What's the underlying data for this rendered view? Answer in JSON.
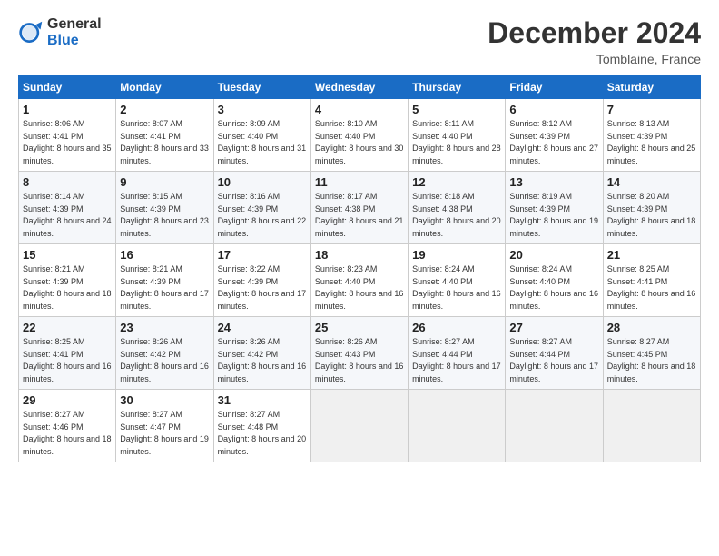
{
  "logo": {
    "general": "General",
    "blue": "Blue"
  },
  "title": "December 2024",
  "location": "Tomblaine, France",
  "weekdays": [
    "Sunday",
    "Monday",
    "Tuesday",
    "Wednesday",
    "Thursday",
    "Friday",
    "Saturday"
  ],
  "weeks": [
    [
      {
        "day": "1",
        "sunrise": "8:06 AM",
        "sunset": "4:41 PM",
        "daylight": "8 hours and 35 minutes."
      },
      {
        "day": "2",
        "sunrise": "8:07 AM",
        "sunset": "4:41 PM",
        "daylight": "8 hours and 33 minutes."
      },
      {
        "day": "3",
        "sunrise": "8:09 AM",
        "sunset": "4:40 PM",
        "daylight": "8 hours and 31 minutes."
      },
      {
        "day": "4",
        "sunrise": "8:10 AM",
        "sunset": "4:40 PM",
        "daylight": "8 hours and 30 minutes."
      },
      {
        "day": "5",
        "sunrise": "8:11 AM",
        "sunset": "4:40 PM",
        "daylight": "8 hours and 28 minutes."
      },
      {
        "day": "6",
        "sunrise": "8:12 AM",
        "sunset": "4:39 PM",
        "daylight": "8 hours and 27 minutes."
      },
      {
        "day": "7",
        "sunrise": "8:13 AM",
        "sunset": "4:39 PM",
        "daylight": "8 hours and 25 minutes."
      }
    ],
    [
      {
        "day": "8",
        "sunrise": "8:14 AM",
        "sunset": "4:39 PM",
        "daylight": "8 hours and 24 minutes."
      },
      {
        "day": "9",
        "sunrise": "8:15 AM",
        "sunset": "4:39 PM",
        "daylight": "8 hours and 23 minutes."
      },
      {
        "day": "10",
        "sunrise": "8:16 AM",
        "sunset": "4:39 PM",
        "daylight": "8 hours and 22 minutes."
      },
      {
        "day": "11",
        "sunrise": "8:17 AM",
        "sunset": "4:38 PM",
        "daylight": "8 hours and 21 minutes."
      },
      {
        "day": "12",
        "sunrise": "8:18 AM",
        "sunset": "4:38 PM",
        "daylight": "8 hours and 20 minutes."
      },
      {
        "day": "13",
        "sunrise": "8:19 AM",
        "sunset": "4:39 PM",
        "daylight": "8 hours and 19 minutes."
      },
      {
        "day": "14",
        "sunrise": "8:20 AM",
        "sunset": "4:39 PM",
        "daylight": "8 hours and 18 minutes."
      }
    ],
    [
      {
        "day": "15",
        "sunrise": "8:21 AM",
        "sunset": "4:39 PM",
        "daylight": "8 hours and 18 minutes."
      },
      {
        "day": "16",
        "sunrise": "8:21 AM",
        "sunset": "4:39 PM",
        "daylight": "8 hours and 17 minutes."
      },
      {
        "day": "17",
        "sunrise": "8:22 AM",
        "sunset": "4:39 PM",
        "daylight": "8 hours and 17 minutes."
      },
      {
        "day": "18",
        "sunrise": "8:23 AM",
        "sunset": "4:40 PM",
        "daylight": "8 hours and 16 minutes."
      },
      {
        "day": "19",
        "sunrise": "8:24 AM",
        "sunset": "4:40 PM",
        "daylight": "8 hours and 16 minutes."
      },
      {
        "day": "20",
        "sunrise": "8:24 AM",
        "sunset": "4:40 PM",
        "daylight": "8 hours and 16 minutes."
      },
      {
        "day": "21",
        "sunrise": "8:25 AM",
        "sunset": "4:41 PM",
        "daylight": "8 hours and 16 minutes."
      }
    ],
    [
      {
        "day": "22",
        "sunrise": "8:25 AM",
        "sunset": "4:41 PM",
        "daylight": "8 hours and 16 minutes."
      },
      {
        "day": "23",
        "sunrise": "8:26 AM",
        "sunset": "4:42 PM",
        "daylight": "8 hours and 16 minutes."
      },
      {
        "day": "24",
        "sunrise": "8:26 AM",
        "sunset": "4:42 PM",
        "daylight": "8 hours and 16 minutes."
      },
      {
        "day": "25",
        "sunrise": "8:26 AM",
        "sunset": "4:43 PM",
        "daylight": "8 hours and 16 minutes."
      },
      {
        "day": "26",
        "sunrise": "8:27 AM",
        "sunset": "4:44 PM",
        "daylight": "8 hours and 17 minutes."
      },
      {
        "day": "27",
        "sunrise": "8:27 AM",
        "sunset": "4:44 PM",
        "daylight": "8 hours and 17 minutes."
      },
      {
        "day": "28",
        "sunrise": "8:27 AM",
        "sunset": "4:45 PM",
        "daylight": "8 hours and 18 minutes."
      }
    ],
    [
      {
        "day": "29",
        "sunrise": "8:27 AM",
        "sunset": "4:46 PM",
        "daylight": "8 hours and 18 minutes."
      },
      {
        "day": "30",
        "sunrise": "8:27 AM",
        "sunset": "4:47 PM",
        "daylight": "8 hours and 19 minutes."
      },
      {
        "day": "31",
        "sunrise": "8:27 AM",
        "sunset": "4:48 PM",
        "daylight": "8 hours and 20 minutes."
      },
      null,
      null,
      null,
      null
    ]
  ],
  "labels": {
    "sunrise": "Sunrise:",
    "sunset": "Sunset:",
    "daylight": "Daylight:"
  }
}
